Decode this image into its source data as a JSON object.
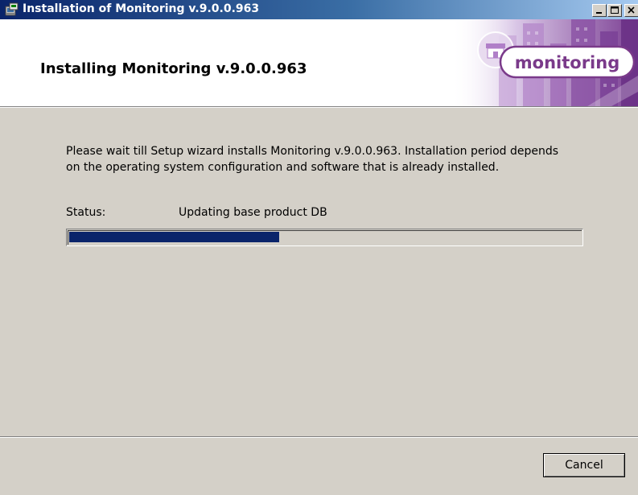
{
  "window": {
    "title": "Installation of Monitoring v.9.0.0.963",
    "icon": "installer-icon",
    "controls": {
      "minimize_icon": "minimize-icon",
      "maximize_icon": "maximize-icon",
      "close_icon": "close-icon"
    }
  },
  "header": {
    "title": "Installing Monitoring v.9.0.0.963",
    "logo_text": "monitoring",
    "logo_icon": "store-icon"
  },
  "body": {
    "description": "Please wait till Setup wizard installs Monitoring v.9.0.0.963. Installation period depends on the operating system configuration and software that is already installed.",
    "status_label": "Status:",
    "status_value": "Updating base product DB",
    "progress_fraction": 0.41
  },
  "footer": {
    "cancel_label": "Cancel"
  },
  "colors": {
    "titlebar_start": "#0a246a",
    "titlebar_end": "#a6caf0",
    "progress_fill": "#0a246a",
    "dialog_bg": "#d4d0c8",
    "brand_purple": "#7a3a8a"
  }
}
